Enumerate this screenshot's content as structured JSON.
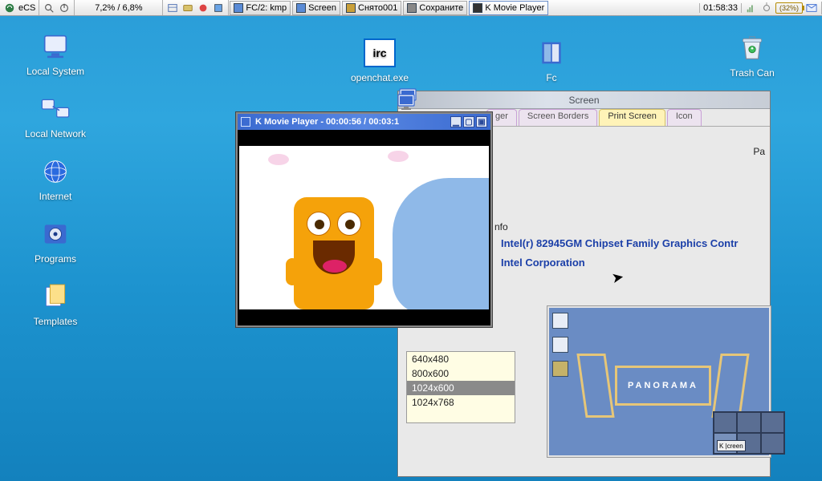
{
  "taskbar": {
    "os_label": "eCS",
    "cpu_text": "7,2% / 6,8%",
    "items": [
      {
        "label": "FC/2: kmp"
      },
      {
        "label": "Screen"
      },
      {
        "label": "Снято001"
      },
      {
        "label": "Сохраните"
      },
      {
        "label": "K Movie Player"
      }
    ],
    "clock": "01:58:33",
    "battery": "(32%)"
  },
  "desktop": {
    "local_system": "Local System",
    "local_network": "Local Network",
    "internet": "Internet",
    "programs": "Programs",
    "templates": "Templates",
    "openchat": "openchat.exe",
    "fc": "Fc",
    "trash": "Trash Can",
    "irc_text": "irc"
  },
  "screen_window": {
    "title": "Screen",
    "tabs": {
      "t_partial": "ger",
      "t_borders": "Screen Borders",
      "t_print": "Print Screen",
      "t_icon": "Icon"
    },
    "pa_label": "Pa",
    "info_label": "nfo",
    "gfx_line1": "Intel(r) 82945GM Chipset Family Graphics Contr",
    "gfx_line2": "Intel Corporation",
    "resolutions": [
      "640x480",
      "800x600",
      "1024x600",
      "1024x768"
    ],
    "selected_resolution": "1024x600",
    "panorama": "PANORAMA",
    "pager_label": "K  |creen"
  },
  "player": {
    "title": "K Movie Player - 00:00:56 / 00:03:1"
  }
}
